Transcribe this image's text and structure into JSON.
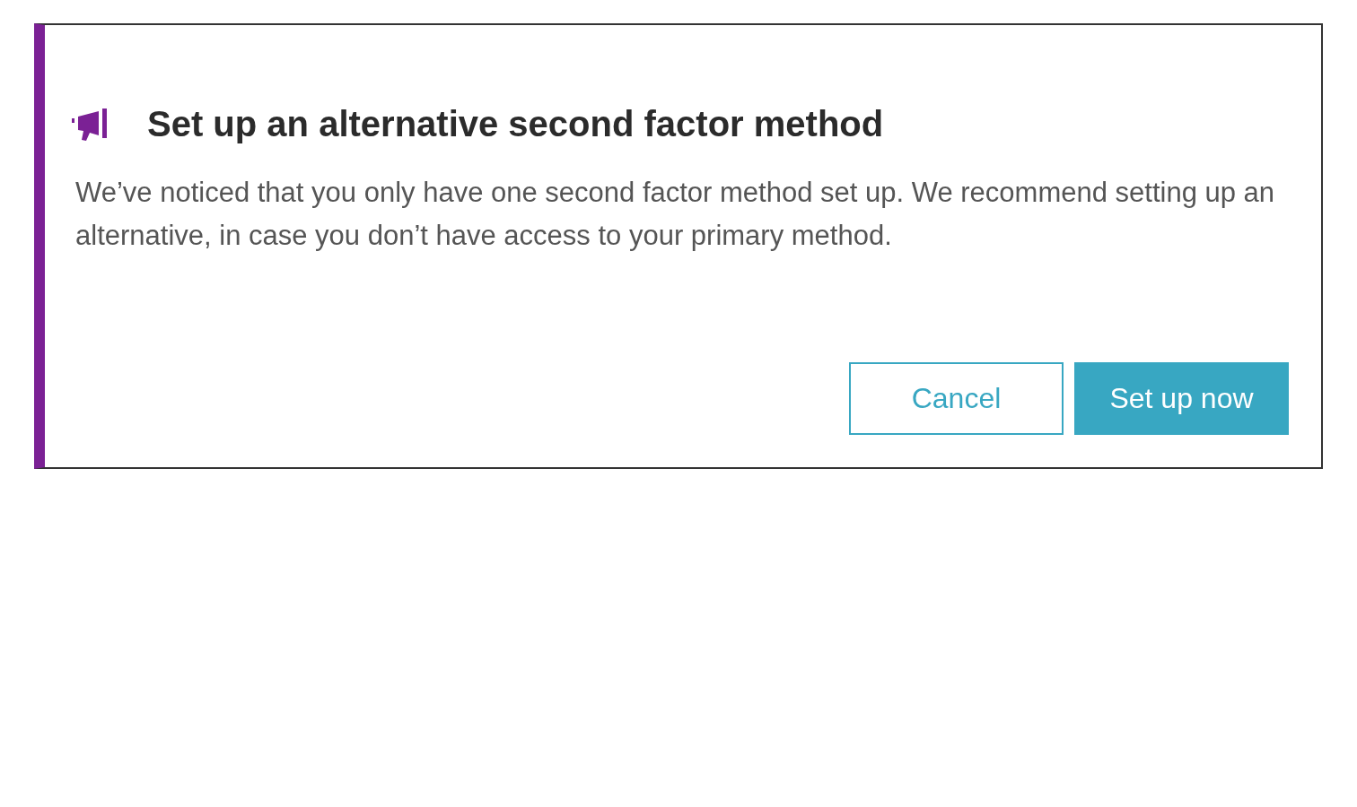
{
  "dialog": {
    "title": "Set up an alternative second factor method",
    "message": "We’ve noticed that you only have one second factor method set up. We recommend setting up an alternative, in case you don’t have access to your primary method.",
    "buttons": [
      {
        "label": "Cancel",
        "kind": "secondary"
      },
      {
        "label": "Set up now",
        "kind": "primary"
      }
    ]
  }
}
